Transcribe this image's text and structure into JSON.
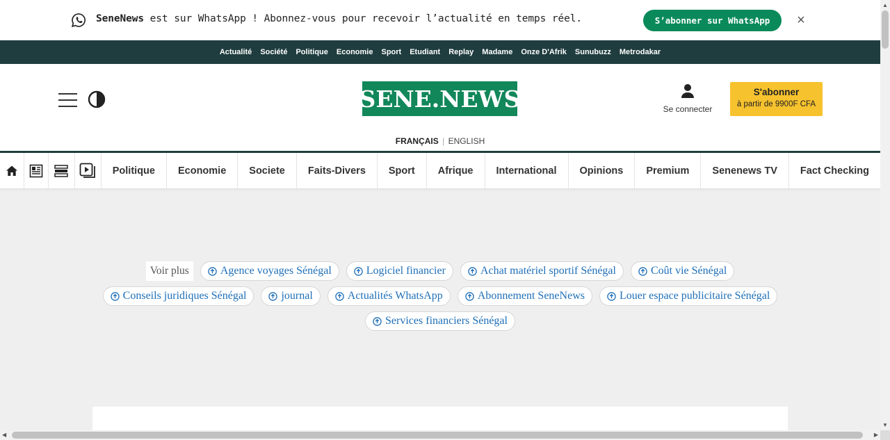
{
  "whatsapp_banner": {
    "brand": "SeneNews",
    "message": " est sur WhatsApp ! Abonnez-vous pour recevoir l’actualité en temps réel.",
    "button_label": "S’abonner sur WhatsApp",
    "close_label": "×"
  },
  "top_nav": {
    "items": [
      "Actualité",
      "Société",
      "Politique",
      "Economie",
      "Sport",
      "Etudiant",
      "Replay",
      "Madame",
      "Onze D'Afrik",
      "Sunubuzz",
      "Metrodakar"
    ]
  },
  "header": {
    "logo_text": "SENE.NEWS",
    "login_label": "Se connecter",
    "subscribe_title": "S'abonner",
    "subscribe_price": "à partir de 9900F CFA",
    "lang_active": "FRANÇAIS",
    "lang_separator": "|",
    "lang_other": "ENGLISH"
  },
  "section_nav": {
    "items": [
      "Politique",
      "Economie",
      "Societe",
      "Faits-Divers",
      "Sport",
      "Afrique",
      "International",
      "Opinions",
      "Premium",
      "Senenews TV",
      "Fact Checking"
    ]
  },
  "tags": {
    "voir_plus": "Voir plus",
    "items": [
      "Agence voyages Sénégal",
      "Logiciel financier",
      "Achat matériel sportif Sénégal",
      "Coût vie Sénégal",
      "Conseils juridiques Sénégal",
      "journal",
      "Actualités WhatsApp",
      "Abonnement SeneNews",
      "Louer espace publicitaire Sénégal",
      "Services financiers Sénégal"
    ]
  },
  "colors": {
    "brand_green": "#11875a",
    "whatsapp_green": "#0a8a5a",
    "nav_dark": "#1f3d3f",
    "subscribe_yellow": "#f6c22e",
    "tag_link": "#1e6fb8"
  },
  "icons": {
    "whatsapp": "whatsapp-icon",
    "close": "close-icon",
    "menu": "hamburger-icon",
    "contrast": "contrast-icon",
    "user": "user-icon",
    "home": "home-icon",
    "newspaper": "newspaper-icon",
    "list": "list-icon",
    "video": "video-icon",
    "tag": "arrow-up-circle-icon"
  }
}
